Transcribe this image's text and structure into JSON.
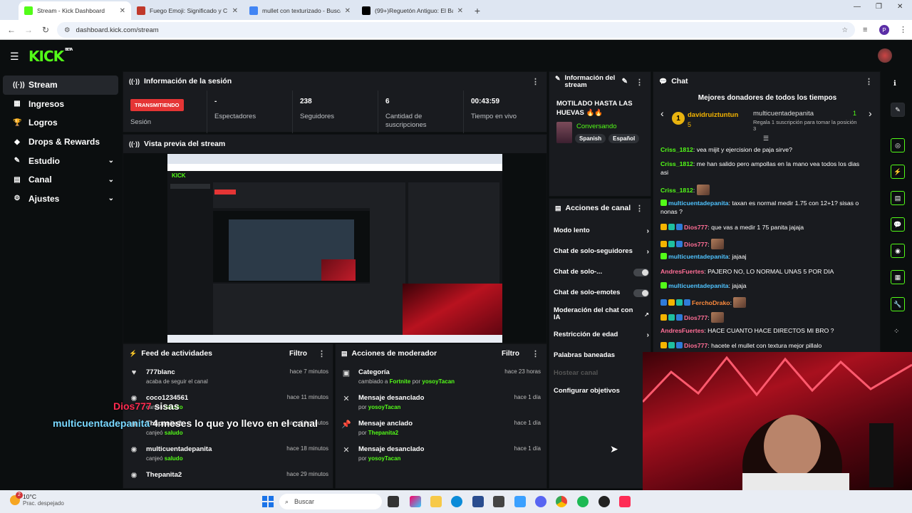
{
  "browser": {
    "tabs": [
      {
        "title": "Stream - Kick Dashboard",
        "active": true,
        "color": "#53fc18"
      },
      {
        "title": "Fuego Emoji: Significado y C",
        "active": false,
        "color": "#c0392b"
      },
      {
        "title": "mullet con texturizado - Buscar",
        "active": false,
        "color": "#4285f4"
      },
      {
        "title": "(99+)Reguetón Antiguo: El Baile",
        "active": false,
        "color": "#000000"
      }
    ],
    "new_tab": "+",
    "url": "dashboard.kick.com/stream",
    "profile_initial": "P"
  },
  "sidebar": {
    "items": [
      {
        "label": "Stream",
        "icon": "((·))",
        "active": true,
        "expand": false
      },
      {
        "label": "Ingresos",
        "icon": "▦",
        "active": false,
        "expand": false
      },
      {
        "label": "Logros",
        "icon": "🏆",
        "active": false,
        "expand": false
      },
      {
        "label": "Drops & Rewards",
        "icon": "◆",
        "active": false,
        "expand": false
      },
      {
        "label": "Estudio",
        "icon": "✎",
        "active": false,
        "expand": true
      },
      {
        "label": "Canal",
        "icon": "▤",
        "active": false,
        "expand": true
      },
      {
        "label": "Ajustes",
        "icon": "⚙",
        "active": false,
        "expand": true
      }
    ]
  },
  "session": {
    "title": "Información de la sesión",
    "status": "TRANSMITIENDO",
    "status_label": "Sesión",
    "stats": [
      {
        "value": "-",
        "label": "Espectadores"
      },
      {
        "value": "238",
        "label": "Seguidores"
      },
      {
        "value": "6",
        "label": "Cantidad de suscripciones"
      },
      {
        "value": "00:43:59",
        "label": "Tiempo en vivo"
      }
    ]
  },
  "preview": {
    "title": "Vista previa del stream"
  },
  "feed": {
    "title": "Feed de actividades",
    "filter": "Filtro",
    "items": [
      {
        "name": "777blanc",
        "sub": "acaba de seguir el canal",
        "time": "hace 7 minutos",
        "icon": "♥"
      },
      {
        "name": "coco1234561",
        "sub_pre": "canjeó ",
        "sub_hl": "saludo",
        "time": "hace 11 minutos",
        "icon": "✺"
      },
      {
        "name": "Thepanita2",
        "sub_pre": "canjeó ",
        "sub_hl": "saludo",
        "time": "hace 14 minutos",
        "icon": "✺"
      },
      {
        "name": "multicuentadepanita",
        "sub_pre": "canjeó ",
        "sub_hl": "saludo",
        "time": "hace 18 minutos",
        "icon": "✺"
      },
      {
        "name": "Thepanita2",
        "sub": "",
        "time": "hace 29 minutos",
        "icon": "✺"
      }
    ]
  },
  "mod_actions": {
    "title": "Acciones de moderador",
    "filter": "Filtro",
    "items": [
      {
        "name": "Categoría",
        "pre": "cambiado a ",
        "hl": "Fortnite",
        "mid": " por ",
        "user": "yosoyTacan",
        "time": "hace 23 horas",
        "icon": "▣"
      },
      {
        "name": "Mensaje desanclado",
        "pre": "",
        "hl": "",
        "mid": "por ",
        "user": "yosoyTacan",
        "time": "hace 1 día",
        "icon": "✕"
      },
      {
        "name": "Mensaje anclado",
        "pre": "",
        "hl": "",
        "mid": "por ",
        "user": "Thepanita2",
        "time": "hace 1 día",
        "icon": "📌"
      },
      {
        "name": "Mensaje desanclado",
        "pre": "",
        "hl": "",
        "mid": "por ",
        "user": "yosoyTacan",
        "time": "hace 1 día",
        "icon": "✕"
      }
    ]
  },
  "stream_info": {
    "title": "Información del stream",
    "stream_title": "MOTILADO HASTA LAS HUEVAS 🔥🔥",
    "category": "Conversando",
    "tags": [
      "Spanish",
      "Español"
    ]
  },
  "channel_actions": {
    "title": "Acciones de canal",
    "items": [
      {
        "label": "Modo lento",
        "control": "chevron",
        "disabled": false
      },
      {
        "label": "Chat de solo-seguidores",
        "control": "chevron",
        "disabled": false
      },
      {
        "label": "Chat de solo-...",
        "control": "toggle",
        "disabled": false
      },
      {
        "label": "Chat de solo-emotes",
        "control": "toggle",
        "disabled": false
      },
      {
        "label": "Moderación del chat con IA",
        "control": "chart",
        "disabled": false
      },
      {
        "label": "Restricción de edad",
        "control": "chevron",
        "disabled": false
      },
      {
        "label": "Palabras baneadas",
        "control": "none",
        "disabled": false
      },
      {
        "label": "Hostear canal",
        "control": "none",
        "disabled": true
      },
      {
        "label": "Configurar objetivos",
        "control": "none",
        "disabled": false
      }
    ]
  },
  "chat": {
    "title": "Chat",
    "donors_title": "Mejores donadores de todos los tiempos",
    "donor1": {
      "name": "davidruiztuntun",
      "count": "5",
      "rank": "1"
    },
    "donor2": {
      "name": "multicuentadepanita",
      "count": "1",
      "note": "Regala 1 suscripción para tomar la posición 3"
    },
    "messages": [
      {
        "user": "Criss_1812",
        "cls": "u-g",
        "badges": [],
        "text": "vea mijit y ejercision de paja sirve?"
      },
      {
        "user": "Criss_1812",
        "cls": "u-g",
        "badges": [],
        "text": "me han salido pero ampollas en la mano vea todos los dias asi"
      },
      {
        "user": "Criss_1812",
        "cls": "u-g",
        "badges": [],
        "text": "",
        "emote": true
      },
      {
        "user": "multicuentadepanita",
        "cls": "u-b",
        "badges": [
          "#53fc18"
        ],
        "text": "taxan es normal medir 1.75 con 12+1? sisas o nonas ?"
      },
      {
        "user": "Dios777",
        "cls": "u-p",
        "badges": [
          "#f4b400",
          "#1fbf9f",
          "#2f7bd8"
        ],
        "text": "que vas a medir 1 75 panita jajaja"
      },
      {
        "user": "Dios777",
        "cls": "u-p",
        "badges": [
          "#f4b400",
          "#1fbf9f",
          "#2f7bd8"
        ],
        "text": "",
        "emote": true
      },
      {
        "user": "multicuentadepanita",
        "cls": "u-b",
        "badges": [
          "#53fc18"
        ],
        "text": "jajaaj"
      },
      {
        "user": "AndresFuertes",
        "cls": "u-p",
        "badges": [],
        "text": "PAJERO NO, LO NORMAL UNAS 5 POR DIA"
      },
      {
        "user": "multicuentadepanita",
        "cls": "u-b",
        "badges": [
          "#53fc18"
        ],
        "text": "jajaja"
      },
      {
        "user": "FerchoDrako",
        "cls": "u-o",
        "badges": [
          "#2f7bd8",
          "#f4b400",
          "#1fbf9f",
          "#2f7bd8"
        ],
        "text": "",
        "emote": true
      },
      {
        "user": "Dios777",
        "cls": "u-p",
        "badges": [
          "#f4b400",
          "#1fbf9f",
          "#2f7bd8"
        ],
        "text": "",
        "emote": true
      },
      {
        "user": "AndresFuertes",
        "cls": "u-p",
        "badges": [],
        "text": "HACE CUANTO HACE DIRECTOS MI BRO ?"
      },
      {
        "user": "Dios777",
        "cls": "u-p",
        "badges": [
          "#f4b400",
          "#1fbf9f",
          "#2f7bd8"
        ],
        "text": "hacete el mullet con textura mejor pillalo"
      }
    ]
  },
  "overlay": {
    "user1": "Dios777",
    "msg1": "sisas",
    "user2": "multicuentadepanita",
    "msg2": "4 meses lo que yo llevo en el canal"
  },
  "taskbar": {
    "weather_temp": "10°C",
    "weather_desc": "Prac. despejado",
    "weather_badge": "2",
    "search_placeholder": "Buscar"
  },
  "colors": {
    "accent": "#53fc18",
    "live": "#e53535",
    "panel": "#191b1f"
  }
}
